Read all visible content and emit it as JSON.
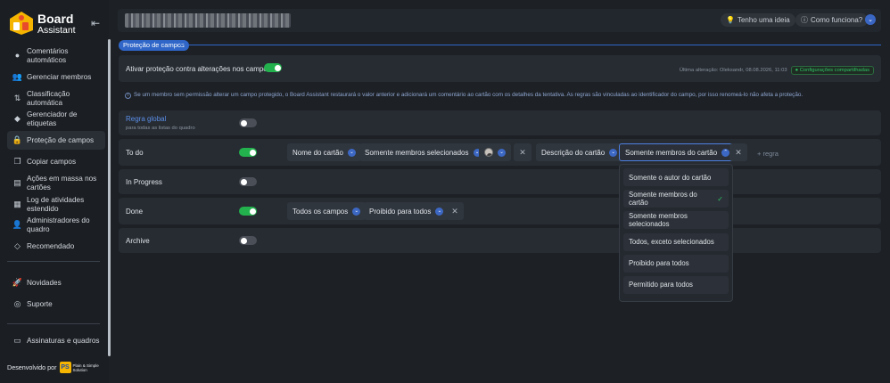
{
  "app": {
    "name_line1": "Board",
    "name_line2": "Assistant"
  },
  "sidebar": {
    "collapse_icon": "collapse-left-icon",
    "items": [
      {
        "label": "Comentários automáticos",
        "icon": "chat-icon"
      },
      {
        "label": "Gerenciar membros",
        "icon": "users-icon"
      },
      {
        "label": "Classificação automática",
        "icon": "sort-icon"
      },
      {
        "label": "Gerenciador de etiquetas",
        "icon": "tag-icon"
      },
      {
        "label": "Proteção de campos",
        "icon": "lock-icon",
        "active": true
      },
      {
        "label": "Copiar campos",
        "icon": "copy-icon"
      },
      {
        "label": "Ações em massa nos cartões",
        "icon": "bulk-icon"
      },
      {
        "label": "Log de atividades estendido",
        "icon": "log-icon"
      },
      {
        "label": "Administradores do quadro",
        "icon": "admin-icon"
      },
      {
        "label": "Recomendado",
        "icon": "diamond-icon"
      }
    ],
    "secondary": [
      {
        "label": "Novidades",
        "icon": "rocket-icon"
      },
      {
        "label": "Suporte",
        "icon": "support-icon"
      }
    ],
    "billing": {
      "label": "Assinaturas e quadros",
      "icon": "card-icon"
    },
    "developed_by": "Desenvolvido por",
    "partner_logo": {
      "mark": "PS",
      "line1": "Plain & Simple",
      "line2": "Solution"
    }
  },
  "header": {
    "idea_button": "Tenho uma ideia",
    "how_button": "Como funciona?"
  },
  "section": {
    "title": "Proteção de campos"
  },
  "protection": {
    "label": "Ativar proteção contra alterações nos campos",
    "enabled": true,
    "last_change": "Última alteração: Oleksandr, 08.08.2026, 11:03",
    "shared_badge": "Configurações compartilhadas"
  },
  "info": "Se um membro sem permissão alterar um campo protegido, o Board Assistant restaurará o valor anterior e adicionará um comentário ao cartão com os detalhes da tentativa. As regras são vinculadas ao identificador do campo, por isso renomeá-lo não afeta a proteção.",
  "global_rule": {
    "title": "Regra global",
    "subtitle": "para todas as listas do quadro",
    "enabled": false
  },
  "lists": [
    {
      "name": "To do",
      "enabled": true
    },
    {
      "name": "In Progress",
      "enabled": false
    },
    {
      "name": "Done",
      "enabled": true
    },
    {
      "name": "Archive",
      "enabled": false
    }
  ],
  "todo_rules": {
    "rule1_field": "Nome do cartão",
    "rule1_access": "Somente membros selecionados",
    "rule2_field": "Descrição do cartão",
    "rule2_access": "Somente membros do cartão",
    "add_rule": "+ regra"
  },
  "done_rules": {
    "rule1_field": "Todos os campos",
    "rule1_access": "Proibido para todos"
  },
  "dropdown": {
    "options": [
      {
        "label": "Somente o autor do cartão",
        "selected": false
      },
      {
        "label": "Somente membros do cartão",
        "selected": true
      },
      {
        "label": "Somente membros selecionados",
        "selected": false
      },
      {
        "label": "Todos, exceto selecionados",
        "selected": false
      },
      {
        "label": "Proibido para todos",
        "selected": false
      },
      {
        "label": "Permitido para todos",
        "selected": false
      }
    ]
  },
  "colors": {
    "accent": "#2f66c8",
    "toggle_on": "#23b14d",
    "brand": "#f5b400"
  }
}
